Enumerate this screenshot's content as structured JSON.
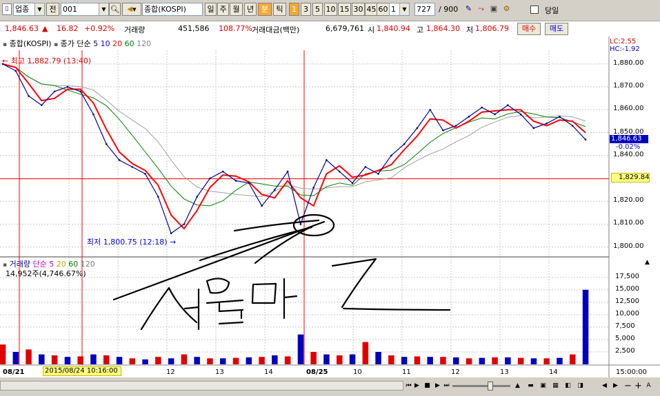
{
  "toolbar": {
    "market_type": "업종",
    "prev_label": "전",
    "code": "001",
    "index_name": "종합(KOSPI)",
    "periods": [
      "일",
      "주",
      "월",
      "년",
      "분",
      "틱"
    ],
    "active_period": "분",
    "minute_options": [
      "1",
      "3",
      "5",
      "10",
      "15",
      "30",
      "45",
      "60"
    ],
    "active_minute": "1",
    "minute_input": "1",
    "count": "727",
    "count_total": "/ 900",
    "checkbox_label": "당일"
  },
  "quote": {
    "price": "1,846.63",
    "change_arrow": "▲",
    "change": "16.82",
    "change_pct": "+0.92%",
    "volume_label": "거래량",
    "volume": "451,586",
    "volume_ratio": "108.77%",
    "value_label": "거래대금(백만)",
    "value": "6,679,761",
    "open_label": "시",
    "open": "1,840.94",
    "high_label": "고",
    "high": "1,864.30",
    "low_label": "저",
    "low": "1,806.79",
    "buy_label": "매수",
    "sell_label": "매도"
  },
  "price_panel": {
    "legend_name": "종합(KOSPI)",
    "legend_ma": "종가 단순",
    "ma_periods": [
      "5",
      "10",
      "20",
      "60",
      "120"
    ],
    "ma_colors": [
      "#000080",
      "#0000ff",
      "#ff0000",
      "#008000",
      "#808080"
    ],
    "lc": "LC:2.55",
    "hc": "HC:-1.92",
    "high_annotation": "최고 1,882.79 (13:40)",
    "low_annotation": "최저 1,800.75 (12:18)",
    "current_price_label": "1,846.63",
    "current_change_label": "-0.02%",
    "hline_label": "1,829.84",
    "yticks": [
      "1,880.00",
      "1,870.00",
      "1,860.00",
      "1,850.00",
      "1,840.00",
      "1,830.00",
      "1,820.00",
      "1,810.00",
      "1,800.00"
    ]
  },
  "volume_panel": {
    "legend_name": "거래량",
    "legend_ma": "단순",
    "ma_periods": [
      "5",
      "20",
      "60",
      "120"
    ],
    "volume_text": "14,952주(4,746.67%)",
    "yticks": [
      "17,500",
      "15,000",
      "12,500",
      "10,000",
      "7,500",
      "5,000",
      "2,500"
    ]
  },
  "xaxis": {
    "labels": [
      "08/21",
      "12",
      "13",
      "14",
      "08/25",
      "10",
      "11",
      "12",
      "13",
      "14"
    ],
    "cursor_label": "2015/08/24 10:16:00",
    "time_label": "15:00:00"
  },
  "annotation": {
    "handwritten_text": "선물매도"
  },
  "chart_data": {
    "type": "line",
    "title": "종합(KOSPI)",
    "series": [
      {
        "name": "종합(KOSPI)",
        "values": [
          1880,
          1877,
          1866,
          1862,
          1868,
          1870,
          1868,
          1858,
          1845,
          1838,
          1835,
          1832,
          1822,
          1806,
          1810,
          1822,
          1830,
          1833,
          1829,
          1828,
          1818,
          1825,
          1833,
          1810,
          1826,
          1838,
          1833,
          1828,
          1835,
          1832,
          1840,
          1845,
          1852,
          1860,
          1851,
          1853,
          1857,
          1861,
          1858,
          1862,
          1858,
          1852,
          1854,
          1857,
          1853,
          1847
        ]
      },
      {
        "name": "거래량",
        "values": [
          4000,
          2500,
          3000,
          2000,
          1800,
          1500,
          1600,
          2000,
          1800,
          1500,
          1200,
          1000,
          1500,
          1200,
          2000,
          1500,
          1200,
          1200,
          1300,
          1400,
          1500,
          1800,
          1600,
          6000,
          2500,
          2000,
          1800,
          2000,
          4500,
          2500,
          1800,
          1500,
          1600,
          1500,
          1500,
          1400,
          1200,
          1300,
          1400,
          1400,
          1300,
          1200,
          1200,
          1300,
          2000,
          15000
        ]
      }
    ],
    "ylim": [
      1796,
      1886
    ],
    "volume_ylim": [
      0,
      19000
    ],
    "horizontal_line": 1829.84,
    "grid": true
  }
}
